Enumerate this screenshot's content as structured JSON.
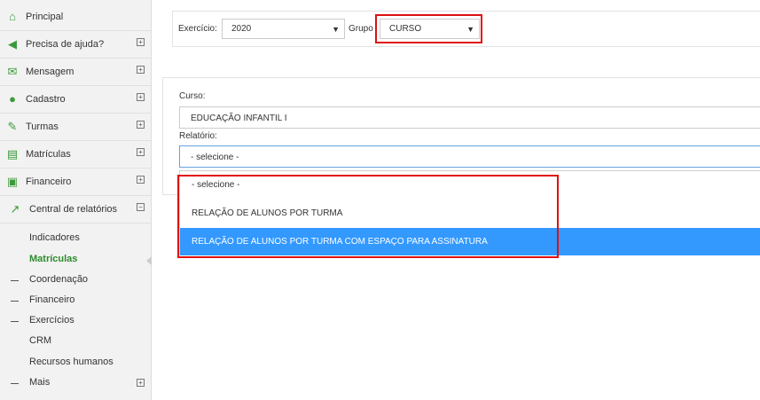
{
  "sidebar": {
    "items": [
      {
        "label": "Principal",
        "icon": "home-icon",
        "glyph": "⌂",
        "toggle": ""
      },
      {
        "label": "Precisa de ajuda?",
        "icon": "megaphone-icon",
        "glyph": "◀",
        "toggle": "+"
      },
      {
        "label": "Mensagem",
        "icon": "envelope-icon",
        "glyph": "✉",
        "toggle": "+"
      },
      {
        "label": "Cadastro",
        "icon": "users-icon",
        "glyph": "●",
        "toggle": "+"
      },
      {
        "label": "Turmas",
        "icon": "pencil-icon",
        "glyph": "✎",
        "toggle": "+"
      },
      {
        "label": "Matrículas",
        "icon": "book-icon",
        "glyph": "▤",
        "toggle": "+"
      },
      {
        "label": "Financeiro",
        "icon": "money-icon",
        "glyph": "▣",
        "toggle": "+"
      },
      {
        "label": "Central de relatórios",
        "icon": "line-chart-icon",
        "glyph": "↗",
        "toggle": "−"
      }
    ],
    "subitems": [
      {
        "label": "Indicadores",
        "dash": false,
        "active": false
      },
      {
        "label": "Matrículas",
        "dash": false,
        "active": true
      },
      {
        "label": "Coordenação",
        "dash": true,
        "active": false
      },
      {
        "label": "Financeiro",
        "dash": true,
        "active": false
      },
      {
        "label": "Exercícios",
        "dash": true,
        "active": false
      },
      {
        "label": "CRM",
        "dash": false,
        "active": false
      },
      {
        "label": "Recursos humanos",
        "dash": false,
        "active": false
      },
      {
        "label": "Mais",
        "dash": true,
        "active": false,
        "toggle": "+"
      }
    ]
  },
  "filters": {
    "exercicio_label": "Exercício:",
    "exercicio_value": "2020",
    "grupo_label": "Grupo",
    "grupo_value": "CURSO"
  },
  "report": {
    "curso_label": "Curso:",
    "curso_value": "EDUCAÇÃO INFANTIL I",
    "relatorio_label": "Relatório:",
    "relatorio_value": "- selecione -",
    "options": [
      {
        "label": "- selecione -",
        "selected": false
      },
      {
        "label": "RELAÇÃO DE ALUNOS POR TURMA",
        "selected": false
      },
      {
        "label": "RELAÇÃO DE ALUNOS POR TURMA COM ESPAÇO PARA ASSINATURA",
        "selected": true
      }
    ]
  },
  "colors": {
    "accent_green": "#3a9a3a",
    "highlight_red": "#e01010",
    "selection_blue": "#3399ff"
  }
}
